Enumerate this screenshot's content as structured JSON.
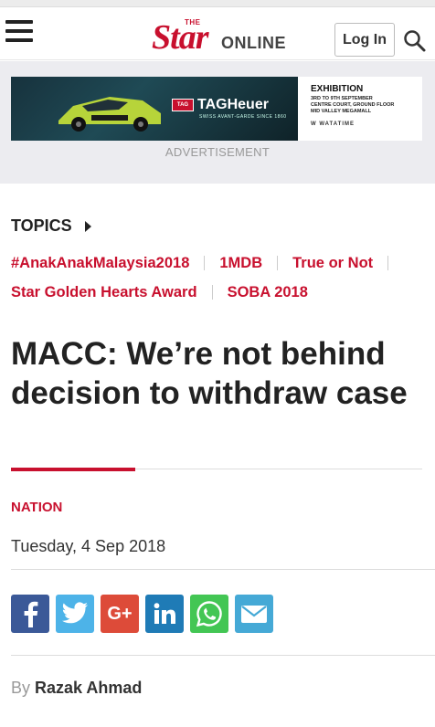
{
  "header": {
    "logo_the": "THE",
    "logo_star": "Star",
    "logo_online": "ONLINE",
    "login_label": "Log In"
  },
  "ad": {
    "brand": "TAGHeuer",
    "brand_badge": "TAG",
    "brand_tagline": "SWISS AVANT-GARDE SINCE 1860",
    "exhibition_title": "EXHIBITION",
    "exhibition_lines": [
      "3RD TO 9TH SEPTEMBER",
      "CENTRE COURT, GROUND FLOOR",
      "MID VALLEY MEGAMALL"
    ],
    "retailer": "W WATATIME",
    "label": "ADVERTISEMENT"
  },
  "topics": {
    "heading": "TOPICS",
    "row1": [
      "#AnakAnakMalaysia2018",
      "1MDB",
      "True or Not"
    ],
    "row2": [
      "Star Golden Hearts Award",
      "SOBA 2018"
    ]
  },
  "article": {
    "headline": "MACC: We’re not behind decision to withdraw case",
    "section": "NATION",
    "date": "Tuesday, 4 Sep 2018",
    "byline_prefix": "By",
    "author": "Razak Ahmad"
  },
  "share": {
    "buttons": [
      "facebook-icon",
      "twitter-icon",
      "google-plus-icon",
      "linkedin-icon",
      "whatsapp-icon",
      "email-icon"
    ],
    "colors": {
      "facebook": "#3b5998",
      "twitter": "#4db3e8",
      "google_plus": "#dd4b39",
      "linkedin": "#1f7bb6",
      "whatsapp": "#43c654",
      "email": "#45a9d6"
    },
    "google_plus_label": "G+"
  },
  "colors": {
    "brand_red": "#c8102e"
  }
}
